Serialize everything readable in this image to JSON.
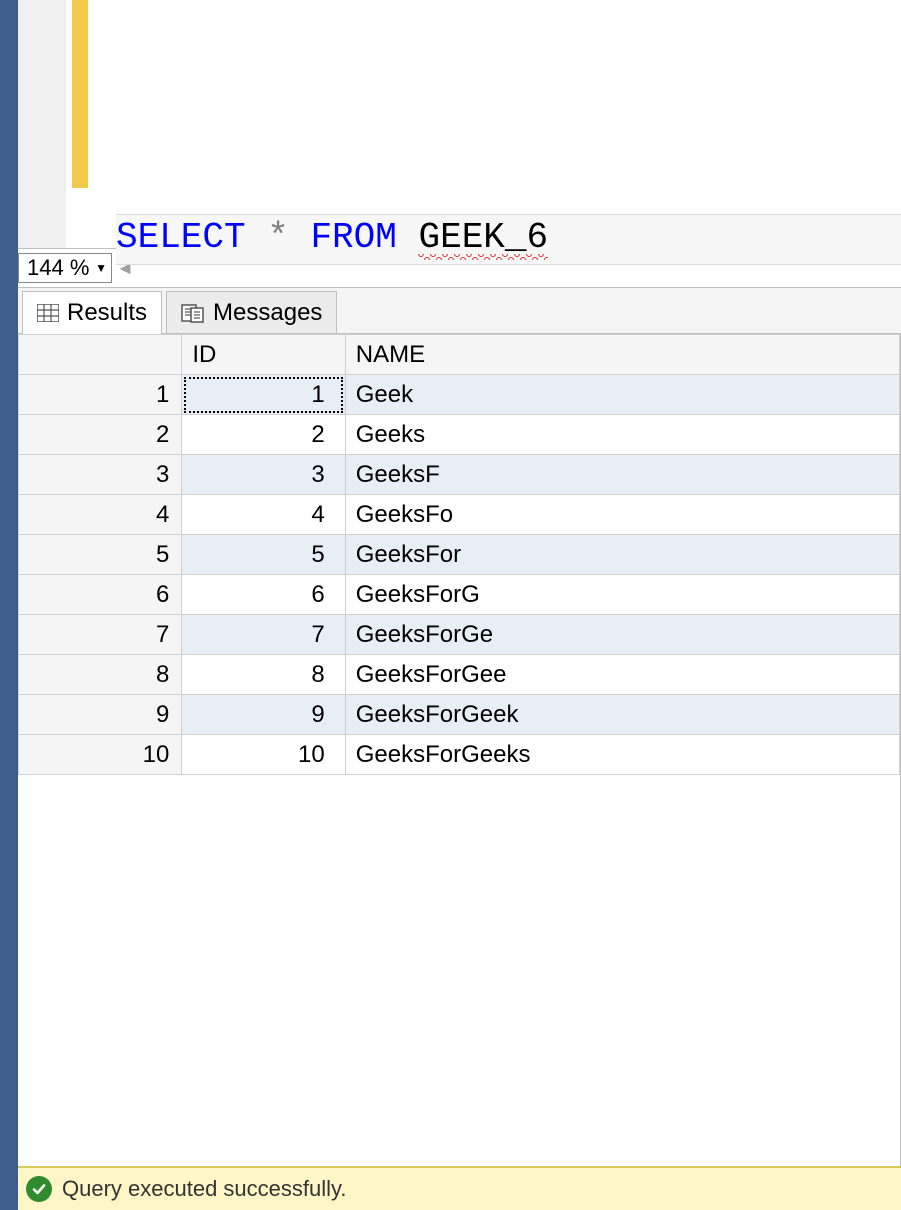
{
  "editor": {
    "query_parts": {
      "select": "SELECT",
      "star": "*",
      "from": "FROM",
      "table": "GEEK_6"
    }
  },
  "zoom": {
    "value": "144 %"
  },
  "tabs": {
    "results_label": "Results",
    "messages_label": "Messages"
  },
  "results": {
    "columns": [
      "ID",
      "NAME"
    ],
    "rows": [
      {
        "rownum": "1",
        "id": "1",
        "name": "Geek"
      },
      {
        "rownum": "2",
        "id": "2",
        "name": "Geeks"
      },
      {
        "rownum": "3",
        "id": "3",
        "name": "GeeksF"
      },
      {
        "rownum": "4",
        "id": "4",
        "name": "GeeksFo"
      },
      {
        "rownum": "5",
        "id": "5",
        "name": "GeeksFor"
      },
      {
        "rownum": "6",
        "id": "6",
        "name": "GeeksForG"
      },
      {
        "rownum": "7",
        "id": "7",
        "name": "GeeksForGe"
      },
      {
        "rownum": "8",
        "id": "8",
        "name": "GeeksForGee"
      },
      {
        "rownum": "9",
        "id": "9",
        "name": "GeeksForGeek"
      },
      {
        "rownum": "10",
        "id": "10",
        "name": "GeeksForGeeks"
      }
    ]
  },
  "status": {
    "message": "Query executed successfully."
  }
}
